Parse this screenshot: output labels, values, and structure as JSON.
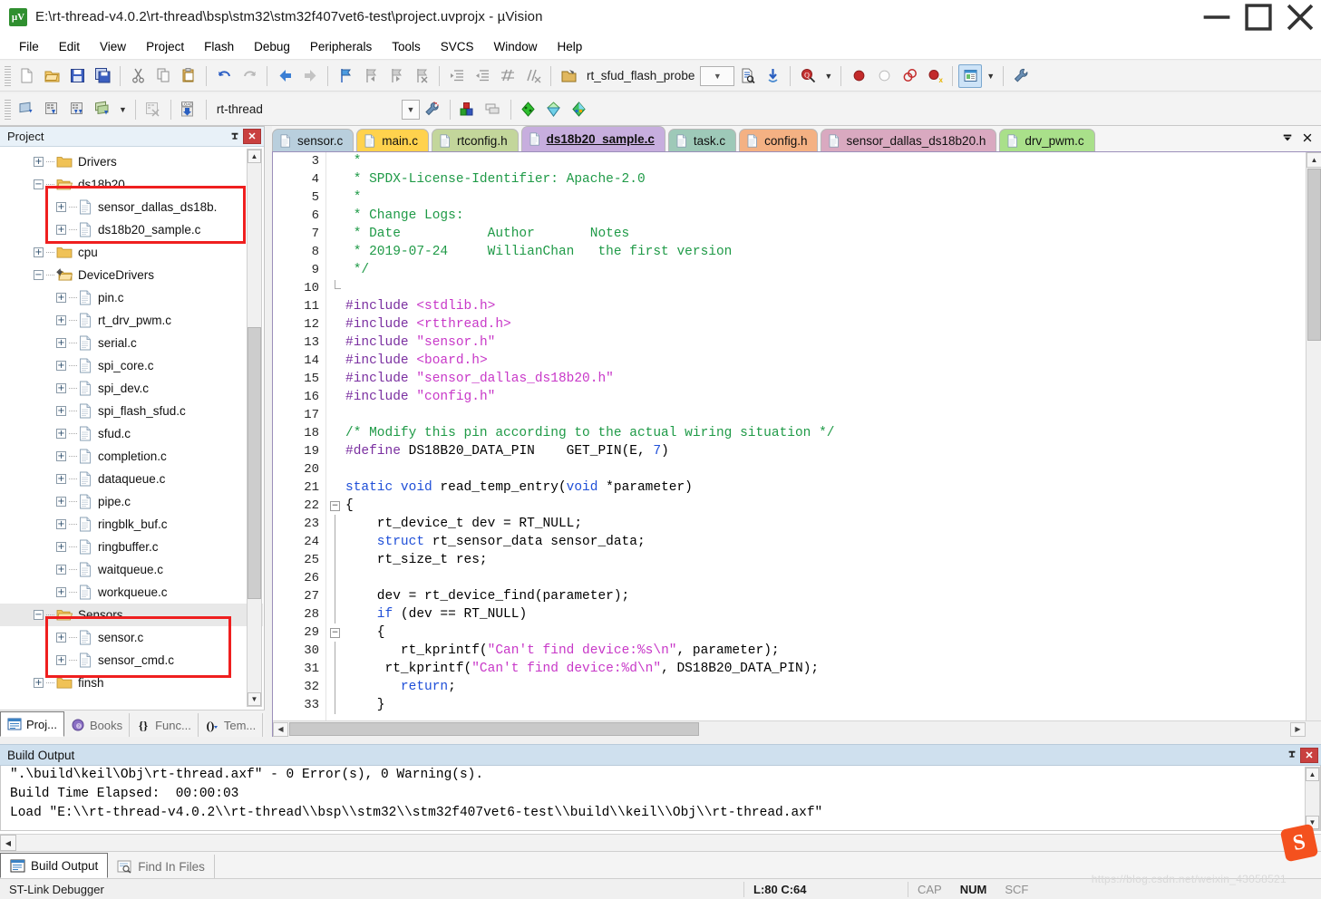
{
  "window": {
    "title": "E:\\rt-thread-v4.0.2\\rt-thread\\bsp\\stm32\\stm32f407vet6-test\\project.uvprojx - µVision",
    "logo_text": "µV",
    "minimize": "—",
    "maximize": "□",
    "close": "✕"
  },
  "menu": [
    "File",
    "Edit",
    "View",
    "Project",
    "Flash",
    "Debug",
    "Peripherals",
    "Tools",
    "SVCS",
    "Window",
    "Help"
  ],
  "toolbar1": {
    "icons": [
      "new-file-icon",
      "open-file-icon",
      "save-icon",
      "save-all-icon",
      "cut-icon",
      "copy-icon",
      "paste-icon",
      "undo-icon",
      "redo-icon",
      "navigate-back-icon",
      "navigate-forward-icon",
      "bookmark-toggle-icon",
      "bookmark-prev-icon",
      "bookmark-next-icon",
      "bookmark-clear-icon",
      "indent-icon",
      "outdent-icon",
      "comment-icon",
      "uncomment-icon",
      "open-project-icon"
    ],
    "function_name": "rt_sfud_flash_probe",
    "after_icons": [
      "find-in-files-icon",
      "insert-reference-icon",
      "search-icon",
      "start-debug-icon",
      "stop-debug-icon",
      "breakpoint-icon",
      "breakpoint-disable-icon",
      "breakpoint-kill-icon",
      "window-layout-icon",
      "configure-icon"
    ]
  },
  "toolbar2": {
    "icons": [
      "translate-icon",
      "build-icon",
      "rebuild-icon",
      "batch-build-icon",
      "stop-build-icon",
      "download-icon"
    ],
    "target": "rt-thread",
    "after_icons": [
      "target-options-icon",
      "manage-project-items-icon",
      "multiproject-icon",
      "configuration-wizard-icon",
      "pack-installer-icon",
      "manage-runtime-icon"
    ]
  },
  "project_panel": {
    "title": "Project",
    "pin": "pin-icon",
    "close": "✕",
    "tree": [
      {
        "indent": 1,
        "type": "folder",
        "expander": "+",
        "label": "Drivers",
        "selected": false
      },
      {
        "indent": 1,
        "type": "folder-open",
        "expander": "−",
        "label": "ds18b20",
        "selected": false
      },
      {
        "indent": 2,
        "type": "file",
        "expander": "+",
        "label": "sensor_dallas_ds18b.",
        "selected": false
      },
      {
        "indent": 2,
        "type": "file",
        "expander": "+",
        "label": "ds18b20_sample.c",
        "selected": false
      },
      {
        "indent": 1,
        "type": "folder",
        "expander": "+",
        "label": "cpu",
        "selected": false
      },
      {
        "indent": 1,
        "type": "folder-gear",
        "expander": "−",
        "label": "DeviceDrivers",
        "selected": false
      },
      {
        "indent": 2,
        "type": "file",
        "expander": "+",
        "label": "pin.c",
        "selected": false
      },
      {
        "indent": 2,
        "type": "file",
        "expander": "+",
        "label": "rt_drv_pwm.c",
        "selected": false
      },
      {
        "indent": 2,
        "type": "file",
        "expander": "+",
        "label": "serial.c",
        "selected": false
      },
      {
        "indent": 2,
        "type": "file",
        "expander": "+",
        "label": "spi_core.c",
        "selected": false
      },
      {
        "indent": 2,
        "type": "file",
        "expander": "+",
        "label": "spi_dev.c",
        "selected": false
      },
      {
        "indent": 2,
        "type": "file",
        "expander": "+",
        "label": "spi_flash_sfud.c",
        "selected": false
      },
      {
        "indent": 2,
        "type": "file",
        "expander": "+",
        "label": "sfud.c",
        "selected": false
      },
      {
        "indent": 2,
        "type": "file",
        "expander": "+",
        "label": "completion.c",
        "selected": false
      },
      {
        "indent": 2,
        "type": "file",
        "expander": "+",
        "label": "dataqueue.c",
        "selected": false
      },
      {
        "indent": 2,
        "type": "file",
        "expander": "+",
        "label": "pipe.c",
        "selected": false
      },
      {
        "indent": 2,
        "type": "file",
        "expander": "+",
        "label": "ringblk_buf.c",
        "selected": false
      },
      {
        "indent": 2,
        "type": "file",
        "expander": "+",
        "label": "ringbuffer.c",
        "selected": false
      },
      {
        "indent": 2,
        "type": "file",
        "expander": "+",
        "label": "waitqueue.c",
        "selected": false
      },
      {
        "indent": 2,
        "type": "file",
        "expander": "+",
        "label": "workqueue.c",
        "selected": false
      },
      {
        "indent": 1,
        "type": "folder-open",
        "expander": "−",
        "label": "Sensors",
        "selected": true
      },
      {
        "indent": 2,
        "type": "file",
        "expander": "+",
        "label": "sensor.c",
        "selected": false
      },
      {
        "indent": 2,
        "type": "file",
        "expander": "+",
        "label": "sensor_cmd.c",
        "selected": false
      },
      {
        "indent": 1,
        "type": "folder",
        "expander": "+",
        "label": "finsh",
        "selected": false
      }
    ],
    "bottom_tabs": [
      {
        "label": "Proj...",
        "icon": "project-icon",
        "active": true
      },
      {
        "label": "Books",
        "icon": "books-icon",
        "active": false
      },
      {
        "label": "Func...",
        "icon": "functions-icon",
        "active": false
      },
      {
        "label": "Tem...",
        "icon": "templates-icon",
        "active": false
      }
    ]
  },
  "editor": {
    "tabs": [
      {
        "label": "sensor.c",
        "color": "#b9cfdd",
        "active": false
      },
      {
        "label": "main.c",
        "color": "#ffd24d",
        "active": false
      },
      {
        "label": "rtconfig.h",
        "color": "#c3d69b",
        "active": false
      },
      {
        "label": "ds18b20_sample.c",
        "color": "#c7aede",
        "active": true
      },
      {
        "label": "task.c",
        "color": "#9ec9b8",
        "active": false
      },
      {
        "label": "config.h",
        "color": "#f4b183",
        "active": false
      },
      {
        "label": "sensor_dallas_ds18b20.h",
        "color": "#d9a9c0",
        "active": false
      },
      {
        "label": "drv_pwm.c",
        "color": "#a9e08a",
        "active": false
      }
    ],
    "tab_tools": {
      "dropdown": "▼",
      "close": "✕"
    },
    "first_line": 3,
    "lines": [
      {
        "n": 3,
        "fold": "",
        "tokens": [
          [
            "com",
            " *"
          ]
        ]
      },
      {
        "n": 4,
        "fold": "",
        "tokens": [
          [
            "com",
            " * SPDX-License-Identifier: Apache-2.0"
          ]
        ]
      },
      {
        "n": 5,
        "fold": "",
        "tokens": [
          [
            "com",
            " *"
          ]
        ]
      },
      {
        "n": 6,
        "fold": "",
        "tokens": [
          [
            "com",
            " * Change Logs:"
          ]
        ]
      },
      {
        "n": 7,
        "fold": "",
        "tokens": [
          [
            "com",
            " * Date           Author       Notes"
          ]
        ]
      },
      {
        "n": 8,
        "fold": "",
        "tokens": [
          [
            "com",
            " * 2019-07-24     WillianChan   the first version"
          ]
        ]
      },
      {
        "n": 9,
        "fold": "",
        "tokens": [
          [
            "com",
            " */"
          ]
        ]
      },
      {
        "n": 10,
        "fold": "end",
        "tokens": [
          [
            "pln",
            ""
          ]
        ]
      },
      {
        "n": 11,
        "fold": "",
        "tokens": [
          [
            "pre",
            "#include "
          ],
          [
            "str",
            "<stdlib.h>"
          ]
        ]
      },
      {
        "n": 12,
        "fold": "",
        "tokens": [
          [
            "pre",
            "#include "
          ],
          [
            "str",
            "<rtthread.h>"
          ]
        ]
      },
      {
        "n": 13,
        "fold": "",
        "tokens": [
          [
            "pre",
            "#include "
          ],
          [
            "str",
            "\"sensor.h\""
          ]
        ]
      },
      {
        "n": 14,
        "fold": "",
        "tokens": [
          [
            "pre",
            "#include "
          ],
          [
            "str",
            "<board.h>"
          ]
        ]
      },
      {
        "n": 15,
        "fold": "",
        "tokens": [
          [
            "pre",
            "#include "
          ],
          [
            "str",
            "\"sensor_dallas_ds18b20.h\""
          ]
        ]
      },
      {
        "n": 16,
        "fold": "",
        "tokens": [
          [
            "pre",
            "#include "
          ],
          [
            "str",
            "\"config.h\""
          ]
        ]
      },
      {
        "n": 17,
        "fold": "",
        "tokens": [
          [
            "pln",
            ""
          ]
        ]
      },
      {
        "n": 18,
        "fold": "",
        "tokens": [
          [
            "com",
            "/* Modify this pin according to the actual wiring situation */"
          ]
        ]
      },
      {
        "n": 19,
        "fold": "",
        "tokens": [
          [
            "pre",
            "#define "
          ],
          [
            "pln",
            "DS18B20_DATA_PIN    GET_PIN(E, "
          ],
          [
            "num",
            "7"
          ],
          [
            "pln",
            ")"
          ]
        ]
      },
      {
        "n": 20,
        "fold": "",
        "tokens": [
          [
            "pln",
            ""
          ]
        ]
      },
      {
        "n": 21,
        "fold": "",
        "tokens": [
          [
            "key",
            "static void "
          ],
          [
            "pln",
            "read_temp_entry("
          ],
          [
            "key",
            "void"
          ],
          [
            "pln",
            " *parameter)"
          ]
        ]
      },
      {
        "n": 22,
        "fold": "open",
        "tokens": [
          [
            "pln",
            "{"
          ]
        ]
      },
      {
        "n": 23,
        "fold": "bar",
        "tokens": [
          [
            "pln",
            "    rt_device_t dev = RT_NULL;"
          ]
        ]
      },
      {
        "n": 24,
        "fold": "bar",
        "tokens": [
          [
            "key",
            "    struct "
          ],
          [
            "pln",
            "rt_sensor_data sensor_data;"
          ]
        ]
      },
      {
        "n": 25,
        "fold": "bar",
        "tokens": [
          [
            "pln",
            "    rt_size_t res;"
          ]
        ]
      },
      {
        "n": 26,
        "fold": "bar",
        "tokens": [
          [
            "pln",
            ""
          ]
        ]
      },
      {
        "n": 27,
        "fold": "bar",
        "tokens": [
          [
            "pln",
            "    dev = rt_device_find(parameter);"
          ]
        ]
      },
      {
        "n": 28,
        "fold": "bar",
        "tokens": [
          [
            "key",
            "    if"
          ],
          [
            "pln",
            " (dev == RT_NULL)"
          ]
        ]
      },
      {
        "n": 29,
        "fold": "open",
        "tokens": [
          [
            "pln",
            "    {"
          ]
        ]
      },
      {
        "n": 30,
        "fold": "bar",
        "tokens": [
          [
            "pln",
            "       rt_kprintf("
          ],
          [
            "str",
            "\"Can't find device:%s\\n\""
          ],
          [
            "pln",
            ", parameter);"
          ]
        ]
      },
      {
        "n": 31,
        "fold": "bar",
        "tokens": [
          [
            "pln",
            "     rt_kprintf("
          ],
          [
            "str",
            "\"Can't find device:%d\\n\""
          ],
          [
            "pln",
            ", DS18B20_DATA_PIN);"
          ]
        ]
      },
      {
        "n": 32,
        "fold": "bar",
        "tokens": [
          [
            "key",
            "       return"
          ],
          [
            "pln",
            ";"
          ]
        ]
      },
      {
        "n": 33,
        "fold": "bar",
        "tokens": [
          [
            "pln",
            "    }"
          ]
        ]
      }
    ]
  },
  "build_output": {
    "title": "Build Output",
    "pin": "pin-icon",
    "close": "✕",
    "lines": [
      "\".\\build\\keil\\Obj\\rt-thread.axf\" - 0 Error(s), 0 Warning(s).",
      "Build Time Elapsed:  00:00:03",
      "Load \"E:\\\\rt-thread-v4.0.2\\\\rt-thread\\\\bsp\\\\stm32\\\\stm32f407vet6-test\\\\build\\\\keil\\\\Obj\\\\rt-thread.axf\""
    ]
  },
  "bottom_tabs": [
    {
      "label": "Build Output",
      "icon": "build-output-icon",
      "active": true
    },
    {
      "label": "Find In Files",
      "icon": "find-in-files-icon",
      "active": false
    }
  ],
  "statusbar": {
    "debugger": "ST-Link Debugger",
    "position": "L:80 C:64",
    "cap": "CAP",
    "num": "NUM",
    "scrl": "SCF"
  },
  "watermark": "https://blog.csdn.net/weixin_43058521",
  "sogou_logo": "S",
  "colors": {
    "accent": "#cfe0ee",
    "annotation_red": "#ef1f1f",
    "comment_green": "#1f9a47",
    "string_magenta": "#c838c8",
    "keyword_blue": "#1f4fd8",
    "preproc_purple": "#7a2fa0"
  }
}
